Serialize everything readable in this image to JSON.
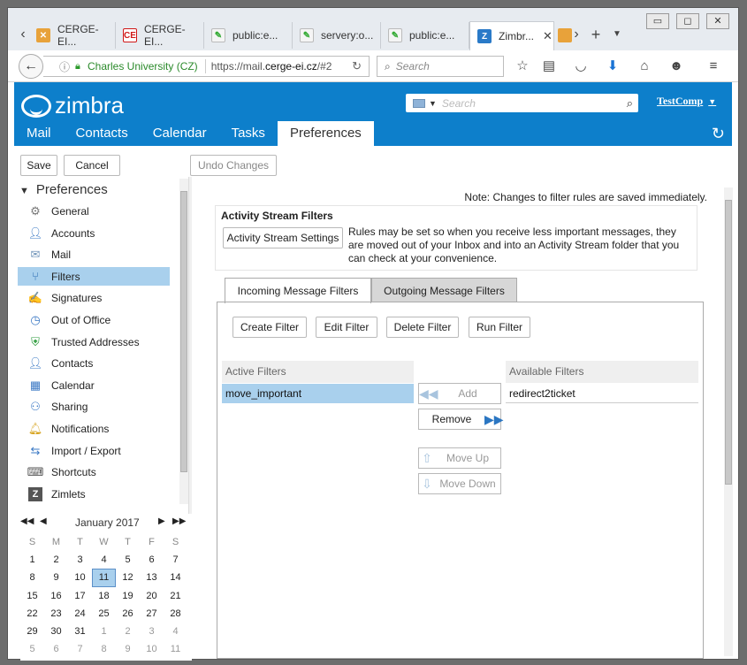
{
  "browser": {
    "tabs": [
      {
        "label": "CERGE-EI..."
      },
      {
        "label": "CERGE-EI..."
      },
      {
        "label": "public:e..."
      },
      {
        "label": "servery:o..."
      },
      {
        "label": "public:e..."
      },
      {
        "label": "Zimbr..."
      }
    ],
    "identity": "Charles University (CZ)",
    "url_prefix": "https://mail.",
    "url_domain": "cerge-ei.cz",
    "url_suffix": "/#2",
    "search_placeholder": "Search"
  },
  "zimbra": {
    "logo": "zimbra",
    "search_placeholder": "Search",
    "user": "TestComp",
    "apps": [
      {
        "label": "Mail"
      },
      {
        "label": "Contacts"
      },
      {
        "label": "Calendar"
      },
      {
        "label": "Tasks"
      },
      {
        "label": "Preferences"
      }
    ]
  },
  "toolbar": {
    "save": "Save",
    "cancel": "Cancel",
    "undo": "Undo Changes"
  },
  "sidebar": {
    "title": "Preferences",
    "items": [
      {
        "label": "General",
        "icon": "gear-icon"
      },
      {
        "label": "Accounts",
        "icon": "accounts-icon"
      },
      {
        "label": "Mail",
        "icon": "envelope-icon"
      },
      {
        "label": "Filters",
        "icon": "filter-icon"
      },
      {
        "label": "Signatures",
        "icon": "signature-icon"
      },
      {
        "label": "Out of Office",
        "icon": "clock-icon"
      },
      {
        "label": "Trusted Addresses",
        "icon": "shield-icon"
      },
      {
        "label": "Contacts",
        "icon": "person-icon"
      },
      {
        "label": "Calendar",
        "icon": "calendar-icon"
      },
      {
        "label": "Sharing",
        "icon": "sharing-icon"
      },
      {
        "label": "Notifications",
        "icon": "bell-icon"
      },
      {
        "label": "Import / Export",
        "icon": "import-export-icon"
      },
      {
        "label": "Shortcuts",
        "icon": "keyboard-icon"
      },
      {
        "label": "Zimlets",
        "icon": "zimlet-icon"
      }
    ]
  },
  "minical": {
    "month": "January 2017",
    "weekdays": [
      "S",
      "M",
      "T",
      "W",
      "T",
      "F",
      "S"
    ],
    "days": [
      "1",
      "2",
      "3",
      "4",
      "5",
      "6",
      "7",
      "8",
      "9",
      "10",
      "11",
      "12",
      "13",
      "14",
      "15",
      "16",
      "17",
      "18",
      "19",
      "20",
      "21",
      "22",
      "23",
      "24",
      "25",
      "26",
      "27",
      "28",
      "29",
      "30",
      "31",
      "1",
      "2",
      "3",
      "4",
      "5",
      "6",
      "7",
      "8",
      "9",
      "10",
      "11"
    ],
    "today": "11"
  },
  "filters": {
    "note": "Note: Changes to filter rules are saved immediately.",
    "asf_title": "Activity Stream Filters",
    "asf_button": "Activity Stream Settings",
    "asf_text": "Rules may be set so when you receive less important messages, they are moved out of your Inbox and into an Activity Stream folder that you can check at your convenience.",
    "tab_incoming": "Incoming Message Filters",
    "tab_outgoing": "Outgoing Message Filters",
    "create": "Create Filter",
    "edit": "Edit Filter",
    "delete": "Delete Filter",
    "run": "Run Filter",
    "active_header": "Active Filters",
    "available_header": "Available Filters",
    "active_items": [
      "move_important"
    ],
    "available_items": [
      "redirect2ticket"
    ],
    "add": "Add",
    "remove": "Remove",
    "move_up": "Move Up",
    "move_down": "Move Down"
  }
}
